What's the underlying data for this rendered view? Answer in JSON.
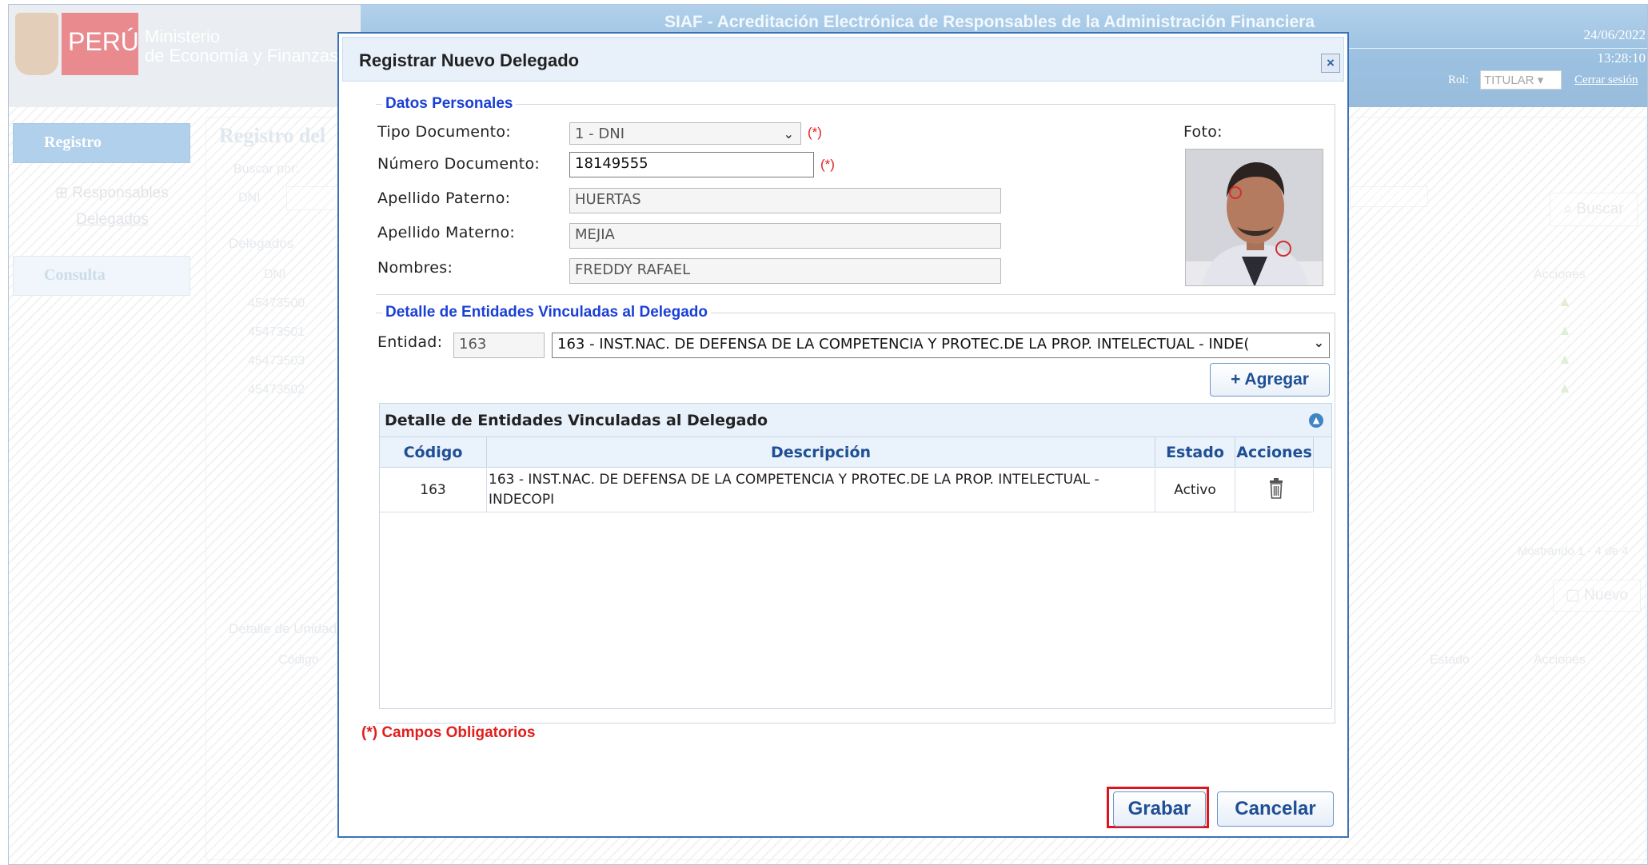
{
  "app": {
    "title": "SIAF - Acreditación Electrónica de Responsables de la Administración Financiera",
    "logo_peru": "PERÚ",
    "logo_ministerio_line1": "Ministerio",
    "logo_ministerio_line2": "de Economía y Finanzas",
    "date": "24/06/2022",
    "time": "13:28:10",
    "rol_label": "Rol:",
    "rol_value": "TITULAR",
    "cerrar_sesion": "Cerrar sesión"
  },
  "sidebar": {
    "registro": "Registro",
    "responsables": "Responsables",
    "delegados": "Delegados",
    "consulta": "Consulta"
  },
  "background": {
    "page_title": "Registro del",
    "buscar_por": "Buscar por:",
    "dni_label": "DNI",
    "buscar_button": "Buscar",
    "delegados_caption": "Delegados",
    "dni_header": "DNI",
    "acciones_header": "Acciones",
    "dni_rows": [
      "45473500",
      "45473501",
      "45473503",
      "45473502"
    ],
    "mostrando": "Mostrando 1 - 4 de 4",
    "nuevo_button": "Nuevo",
    "detalle_unidades": "Detalle de Unidade",
    "codigo_header": "Código",
    "estado_header": "Estado",
    "acciones_header2": "Acciones"
  },
  "dialog": {
    "title": "Registrar Nuevo Delegado",
    "close_glyph": "×",
    "datos_personales": {
      "legend": "Datos Personales",
      "tipo_documento_label": "Tipo Documento:",
      "tipo_documento_value": "1 - DNI",
      "numero_documento_label": "Número Documento:",
      "numero_documento_value": "18149555",
      "apellido_paterno_label": "Apellido Paterno:",
      "apellido_paterno_value": "HUERTAS",
      "apellido_materno_label": "Apellido Materno:",
      "apellido_materno_value": "MEJIA",
      "nombres_label": "Nombres:",
      "nombres_value": "FREDDY RAFAEL",
      "foto_label": "Foto:",
      "required_mark": "(*)"
    },
    "entidades": {
      "legend": "Detalle de Entidades Vinculadas al Delegado",
      "entidad_label": "Entidad:",
      "entidad_code": "163",
      "entidad_select": "163 - INST.NAC. DE DEFENSA DE LA COMPETENCIA Y PROTEC.DE LA PROP. INTELECTUAL - INDE(",
      "agregar_button": "+ Agregar",
      "grid_caption": "Detalle de Entidades Vinculadas al Delegado",
      "columns": [
        "Código",
        "Descripción",
        "Estado",
        "Acciones"
      ],
      "rows": [
        {
          "codigo": "163",
          "descripcion_line1": "163 - INST.NAC. DE DEFENSA DE LA COMPETENCIA Y PROTEC.DE LA PROP. INTELECTUAL -",
          "descripcion_line2": "INDECOPI",
          "estado": "Activo"
        }
      ]
    },
    "campos_obligatorios": "(*) Campos Obligatorios",
    "grabar_button": "Grabar",
    "cancelar_button": "Cancelar"
  }
}
